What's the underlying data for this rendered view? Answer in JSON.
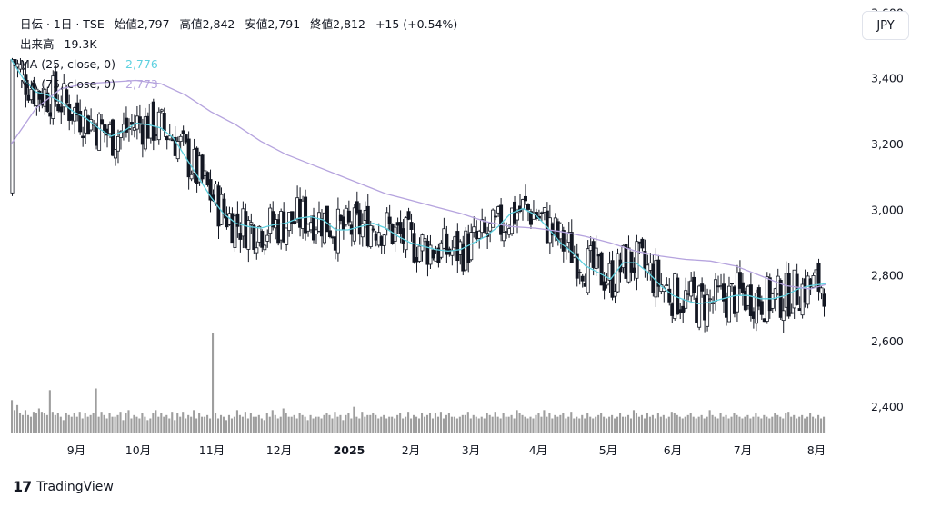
{
  "header": {
    "symbol": "日伝 · 1日 · TSE",
    "open_label": "始値",
    "open": "2,797",
    "high_label": "高値",
    "high": "2,842",
    "low_label": "安値",
    "low": "2,791",
    "close_label": "終値",
    "close": "2,812",
    "change": "+15 (+0.54%)",
    "volume_label": "出来高",
    "volume": "19.3K",
    "ma25_label": "MA (25, close, 0)",
    "ma25_value": "2,776",
    "ma75_label": "MA (75, close, 0)",
    "ma75_value": "2,773"
  },
  "currency_button": "JPY",
  "branding": {
    "name": "TradingView",
    "mark": "17"
  },
  "colors": {
    "up": "#131722",
    "down": "#131722",
    "ma25": "#5fd1e0",
    "ma75": "#b5a3de",
    "volume": "#9e9e9e"
  },
  "chart_data": {
    "type": "candlestick",
    "interval": "1 day",
    "y_axis": {
      "ticks": [
        2400,
        2600,
        2800,
        3000,
        3200,
        3400,
        3600
      ],
      "range": [
        2320,
        3640
      ]
    },
    "x_axis": {
      "tick_labels": [
        "9月",
        "10月",
        "11月",
        "12月",
        "2025",
        "2月",
        "3月",
        "4月",
        "5月",
        "6月",
        "7月",
        "8月"
      ]
    },
    "series": [
      {
        "name": "MA (25, close, 0)",
        "type": "line",
        "color": "#5fd1e0",
        "points": [
          [
            0,
            3460
          ],
          [
            10,
            3400
          ],
          [
            20,
            3360
          ],
          [
            30,
            3350
          ],
          [
            40,
            3330
          ],
          [
            50,
            3300
          ],
          [
            60,
            3280
          ],
          [
            70,
            3250
          ],
          [
            80,
            3225
          ],
          [
            90,
            3240
          ],
          [
            100,
            3265
          ],
          [
            110,
            3260
          ],
          [
            120,
            3250
          ],
          [
            130,
            3220
          ],
          [
            140,
            3160
          ],
          [
            150,
            3100
          ],
          [
            160,
            3040
          ],
          [
            170,
            2990
          ],
          [
            180,
            2960
          ],
          [
            190,
            2950
          ],
          [
            200,
            2945
          ],
          [
            210,
            2955
          ],
          [
            220,
            2960
          ],
          [
            230,
            2975
          ],
          [
            240,
            2980
          ],
          [
            250,
            2970
          ],
          [
            260,
            2940
          ],
          [
            270,
            2940
          ],
          [
            280,
            2950
          ],
          [
            290,
            2960
          ],
          [
            300,
            2945
          ],
          [
            310,
            2920
          ],
          [
            320,
            2900
          ],
          [
            330,
            2890
          ],
          [
            340,
            2880
          ],
          [
            350,
            2875
          ],
          [
            360,
            2880
          ],
          [
            370,
            2900
          ],
          [
            380,
            2920
          ],
          [
            390,
            2950
          ],
          [
            400,
            2990
          ],
          [
            410,
            3005
          ],
          [
            420,
            2985
          ],
          [
            430,
            2945
          ],
          [
            440,
            2900
          ],
          [
            450,
            2870
          ],
          [
            460,
            2830
          ],
          [
            470,
            2810
          ],
          [
            480,
            2790
          ],
          [
            490,
            2840
          ],
          [
            500,
            2840
          ],
          [
            510,
            2810
          ],
          [
            520,
            2770
          ],
          [
            530,
            2740
          ],
          [
            540,
            2725
          ],
          [
            550,
            2715
          ],
          [
            560,
            2720
          ],
          [
            570,
            2730
          ],
          [
            580,
            2740
          ],
          [
            590,
            2740
          ],
          [
            600,
            2730
          ],
          [
            610,
            2730
          ],
          [
            620,
            2740
          ],
          [
            630,
            2760
          ],
          [
            640,
            2770
          ],
          [
            650,
            2775
          ],
          [
            652,
            2776
          ]
        ]
      },
      {
        "name": "MA (75, close, 0)",
        "type": "line",
        "color": "#b5a3de",
        "points": [
          [
            0,
            3200
          ],
          [
            20,
            3310
          ],
          [
            40,
            3370
          ],
          [
            60,
            3385
          ],
          [
            80,
            3390
          ],
          [
            100,
            3395
          ],
          [
            120,
            3385
          ],
          [
            140,
            3350
          ],
          [
            160,
            3300
          ],
          [
            180,
            3260
          ],
          [
            200,
            3210
          ],
          [
            220,
            3170
          ],
          [
            240,
            3140
          ],
          [
            260,
            3110
          ],
          [
            280,
            3080
          ],
          [
            300,
            3050
          ],
          [
            320,
            3030
          ],
          [
            340,
            3010
          ],
          [
            360,
            2990
          ],
          [
            380,
            2965
          ],
          [
            400,
            2950
          ],
          [
            420,
            2945
          ],
          [
            440,
            2935
          ],
          [
            460,
            2920
          ],
          [
            480,
            2900
          ],
          [
            500,
            2875
          ],
          [
            520,
            2860
          ],
          [
            540,
            2850
          ],
          [
            560,
            2845
          ],
          [
            580,
            2830
          ],
          [
            600,
            2800
          ],
          [
            620,
            2770
          ],
          [
            640,
            2760
          ],
          [
            652,
            2773
          ]
        ]
      },
      {
        "name": "volume",
        "type": "bar",
        "values": [
          20,
          14,
          17,
          12,
          11,
          14,
          11,
          10,
          13,
          12,
          15,
          13,
          12,
          11,
          26,
          13,
          11,
          12,
          10,
          8,
          12,
          11,
          10,
          12,
          10,
          13,
          9,
          12,
          10,
          11,
          12,
          27,
          10,
          13,
          11,
          9,
          12,
          10,
          10,
          11,
          13,
          8,
          12,
          14,
          9,
          11,
          10,
          9,
          12,
          10,
          8,
          9,
          12,
          14,
          10,
          12,
          10,
          11,
          9,
          13,
          8,
          12,
          10,
          13,
          9,
          11,
          10,
          14,
          9,
          12,
          10,
          10,
          11,
          9,
          60,
          12,
          9,
          11,
          10,
          8,
          11,
          9,
          10,
          14,
          11,
          10,
          13,
          9,
          12,
          10,
          10,
          11,
          9,
          8,
          12,
          10,
          14,
          11,
          9,
          10,
          15,
          12,
          10,
          10,
          11,
          9,
          12,
          11,
          10,
          8,
          11,
          9,
          10,
          10,
          9,
          11,
          12,
          11,
          9,
          13,
          10,
          11,
          8,
          11,
          12,
          9,
          16,
          10,
          9,
          13,
          10,
          11,
          11,
          12,
          11,
          9,
          10,
          11,
          9,
          10,
          10,
          9,
          11,
          12,
          9,
          10,
          13,
          9,
          11,
          10,
          9,
          12,
          10,
          11,
          12,
          9,
          12,
          10,
          13,
          9,
          11,
          12,
          10,
          10,
          9,
          10,
          11,
          11,
          13,
          9,
          11,
          10,
          9,
          10,
          9,
          12,
          11,
          10,
          13,
          10,
          9,
          12,
          10,
          10,
          11,
          9,
          14,
          12,
          11,
          10,
          9,
          10,
          9,
          11,
          12,
          10,
          14,
          10,
          12,
          9,
          11,
          10,
          11,
          12,
          9,
          10,
          13,
          9,
          10,
          9,
          11,
          9,
          12,
          10,
          9,
          10,
          11,
          12,
          10,
          9,
          10,
          11,
          9,
          10,
          12,
          10,
          10,
          11,
          9,
          14,
          12,
          10,
          11,
          9,
          12,
          10,
          11,
          9,
          12,
          10,
          11,
          9,
          10,
          13,
          12,
          11,
          10,
          9,
          10,
          11,
          12,
          10,
          9,
          10,
          11,
          9,
          10,
          14,
          11,
          10,
          9,
          12,
          10,
          11,
          9,
          10,
          12,
          11,
          10,
          9,
          10,
          11,
          9,
          10,
          12,
          10,
          9,
          11,
          10,
          9,
          10,
          12,
          11,
          10,
          9,
          12,
          13,
          10,
          11,
          9,
          10,
          11,
          9,
          10,
          12,
          10,
          9,
          11,
          9,
          10,
          12,
          11,
          10,
          9,
          10,
          11,
          9,
          10,
          12,
          10,
          9,
          11,
          10,
          9,
          10,
          12,
          11,
          10,
          9,
          10,
          11,
          9,
          10,
          12,
          10,
          9,
          11,
          10,
          9,
          10,
          12,
          11,
          10,
          9,
          10,
          11,
          9,
          10,
          12,
          10,
          9
        ]
      }
    ]
  }
}
